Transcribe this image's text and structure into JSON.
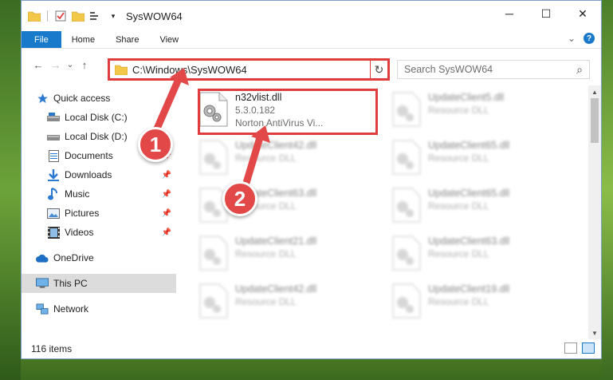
{
  "window": {
    "title": "SysWOW64",
    "controls": {
      "minimize": "─",
      "maximize": "☐",
      "close": "✕"
    }
  },
  "ribbon": {
    "tabs": [
      "File",
      "Home",
      "Share",
      "View"
    ],
    "expand": "⌄",
    "help": "?"
  },
  "nav": {
    "back": "←",
    "forward": "→",
    "recent": "⌄",
    "up": "↑",
    "address": "C:\\Windows\\SysWOW64",
    "address_dropdown": "⌄",
    "refresh": "↻",
    "search_placeholder": "Search SysWOW64",
    "search_icon": "⌕"
  },
  "sidebar": {
    "items": [
      {
        "label": "Quick access",
        "icon": "star-icon",
        "pinned": false
      },
      {
        "label": "Local Disk (C:)",
        "icon": "drive-icon",
        "pinned": true
      },
      {
        "label": "Local Disk (D:)",
        "icon": "drive-icon",
        "pinned": true
      },
      {
        "label": "Documents",
        "icon": "documents-icon",
        "pinned": true
      },
      {
        "label": "Downloads",
        "icon": "download-icon",
        "pinned": true
      },
      {
        "label": "Music",
        "icon": "music-icon",
        "pinned": true
      },
      {
        "label": "Pictures",
        "icon": "pictures-icon",
        "pinned": true
      },
      {
        "label": "Videos",
        "icon": "video-icon",
        "pinned": true
      },
      {
        "label": "OneDrive",
        "icon": "cloud-icon",
        "pinned": false
      },
      {
        "label": "This PC",
        "icon": "computer-icon",
        "pinned": false,
        "selected": true
      },
      {
        "label": "Network",
        "icon": "network-icon",
        "pinned": false
      }
    ],
    "pin_glyph": "📌"
  },
  "files": {
    "highlighted": {
      "name": "n32vlist.dll",
      "version": "5.3.0.182",
      "description": "Norton AntiVirus Vi..."
    },
    "others": [
      {
        "name": "UpdateClient5.dll",
        "description": "Resource DLL"
      },
      {
        "name": "UpdateClient42.dll",
        "description": "Resource DLL"
      },
      {
        "name": "UpdateClient65.dll",
        "description": "Resource DLL"
      },
      {
        "name": "UpdateClient63.dll",
        "description": "Resource DLL"
      },
      {
        "name": "UpdateClient65.dll",
        "description": "Resource DLL"
      },
      {
        "name": "UpdateClient21.dll",
        "description": "Resource DLL"
      },
      {
        "name": "UpdateClient63.dll",
        "description": "Resource DLL"
      },
      {
        "name": "UpdateClient42.dll",
        "description": "Resource DLL"
      },
      {
        "name": "UpdateClient19.dll",
        "description": "Resource DLL"
      }
    ]
  },
  "status": {
    "items": "116 items"
  },
  "callouts": {
    "one": "1",
    "two": "2"
  },
  "colors": {
    "accent": "#1979ca",
    "annotation": "#e03c3c",
    "selected": "#dcdcdc"
  }
}
